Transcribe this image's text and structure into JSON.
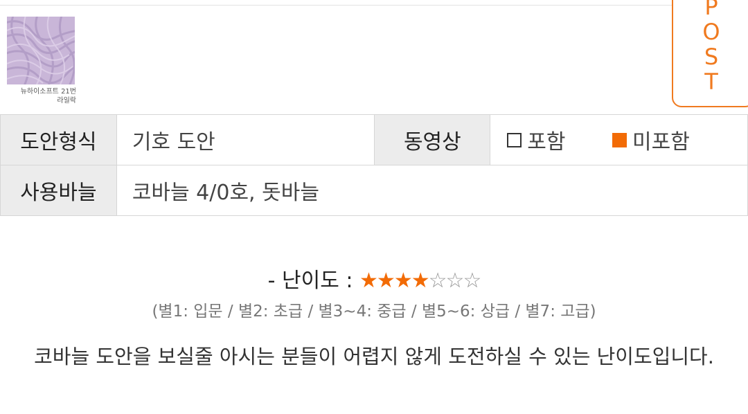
{
  "post_tab": {
    "letters": [
      "P",
      "O",
      "S",
      "T"
    ],
    "color": "#f07a1f"
  },
  "yarn": {
    "caption_line1": "뉴하이소프트 21번",
    "caption_line2": "라일락",
    "swatch_color": "#c8b4d6"
  },
  "table": {
    "pattern_type_label": "도안형식",
    "pattern_type_value": "기호 도안",
    "video_label": "동영상",
    "video_options": [
      {
        "label": "포함",
        "checked": false
      },
      {
        "label": "미포함",
        "checked": true
      }
    ],
    "needle_label": "사용바늘",
    "needle_value": "코바늘 4/0호, 돗바늘"
  },
  "difficulty": {
    "label": "- 난이도 :",
    "rating": 4,
    "max": 7,
    "legend": "(별1: 입문 / 별2: 초급 / 별3~4: 중급 / 별5~6: 상급 / 별7: 고급)",
    "description": "코바늘 도안을 보실줄 아시는 분들이 어렵지 않게 도전하실 수 있는 난이도입니다."
  }
}
